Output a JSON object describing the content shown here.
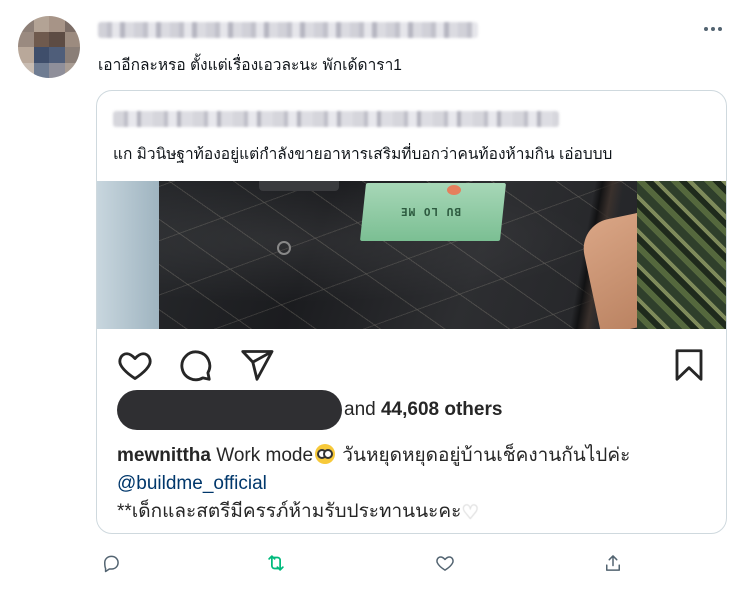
{
  "tweet": {
    "text": "เอาอีกละหรอ ตั้งแต่เรื่องเอวละนะ พักเด้ดารา1"
  },
  "quoted_tweet": {
    "text": "แก มิวนิษฐาท้องอยู่แต่กำลังขายอาหารเสริมที่บอกว่าคนท้องห้ามกิน เอ่อบบบ"
  },
  "instagram_post": {
    "photo_box_label": "BU LO ME",
    "likes_suffix_prefix": "and ",
    "likes_count": "44,608 others",
    "caption_user": "mewnittha",
    "caption_line1_a": " Work mode",
    "caption_line1_b": " วันหยุดหยุดอยู่บ้านเช็คงานกันไปค่ะ",
    "caption_mention": "@buildme_official",
    "caption_line3": "**เด็กและสตรีมีครรภ์ห้ามรับประทานนะคะ",
    "caption_line3_emoji": "♡"
  },
  "colors": {
    "icon_gray": "#536471",
    "retweet_green": "#00ba7c",
    "ig_text": "#262626",
    "ig_link": "#00376b"
  },
  "icons": [
    "more-icon",
    "heart-icon",
    "comment-icon",
    "share-icon",
    "bookmark-icon",
    "reply-icon",
    "retweet-icon",
    "like-icon",
    "upload-icon"
  ]
}
